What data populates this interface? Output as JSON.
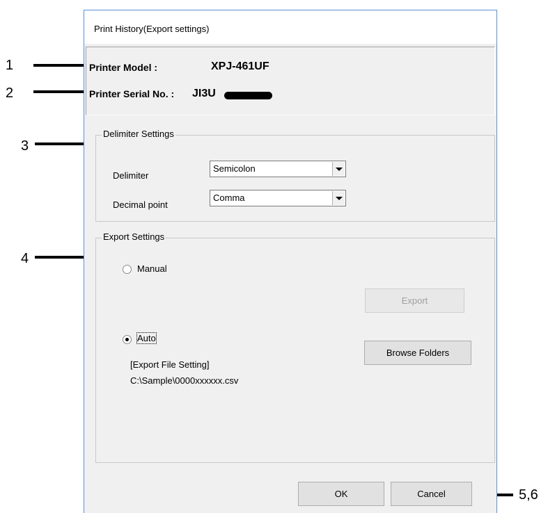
{
  "dialog": {
    "title": "Print History(Export settings)",
    "printer_model_label": "Printer Model :",
    "printer_model_value": "XPJ-461UF",
    "printer_serial_label": "Printer Serial No. :",
    "printer_serial_value": "JI3U"
  },
  "delimiter_settings": {
    "title": "Delimiter Settings",
    "delimiter_label": "Delimiter",
    "delimiter_value": "Semicolon",
    "decimal_label": "Decimal point",
    "decimal_value": "Comma"
  },
  "export_settings": {
    "title": "Export Settings",
    "manual_label": "Manual",
    "manual_selected": false,
    "export_button": "Export",
    "auto_label": "Auto",
    "auto_selected": true,
    "browse_button": "Browse Folders",
    "file_setting_heading": "[Export File Setting]",
    "file_path": "C:\\Sample\\0000xxxxxx.csv"
  },
  "footer": {
    "ok_button": "OK",
    "cancel_button": "Cancel"
  },
  "callouts": {
    "c1": "1",
    "c2": "2",
    "c3": "3",
    "c4": "4",
    "c56": "5,6"
  }
}
